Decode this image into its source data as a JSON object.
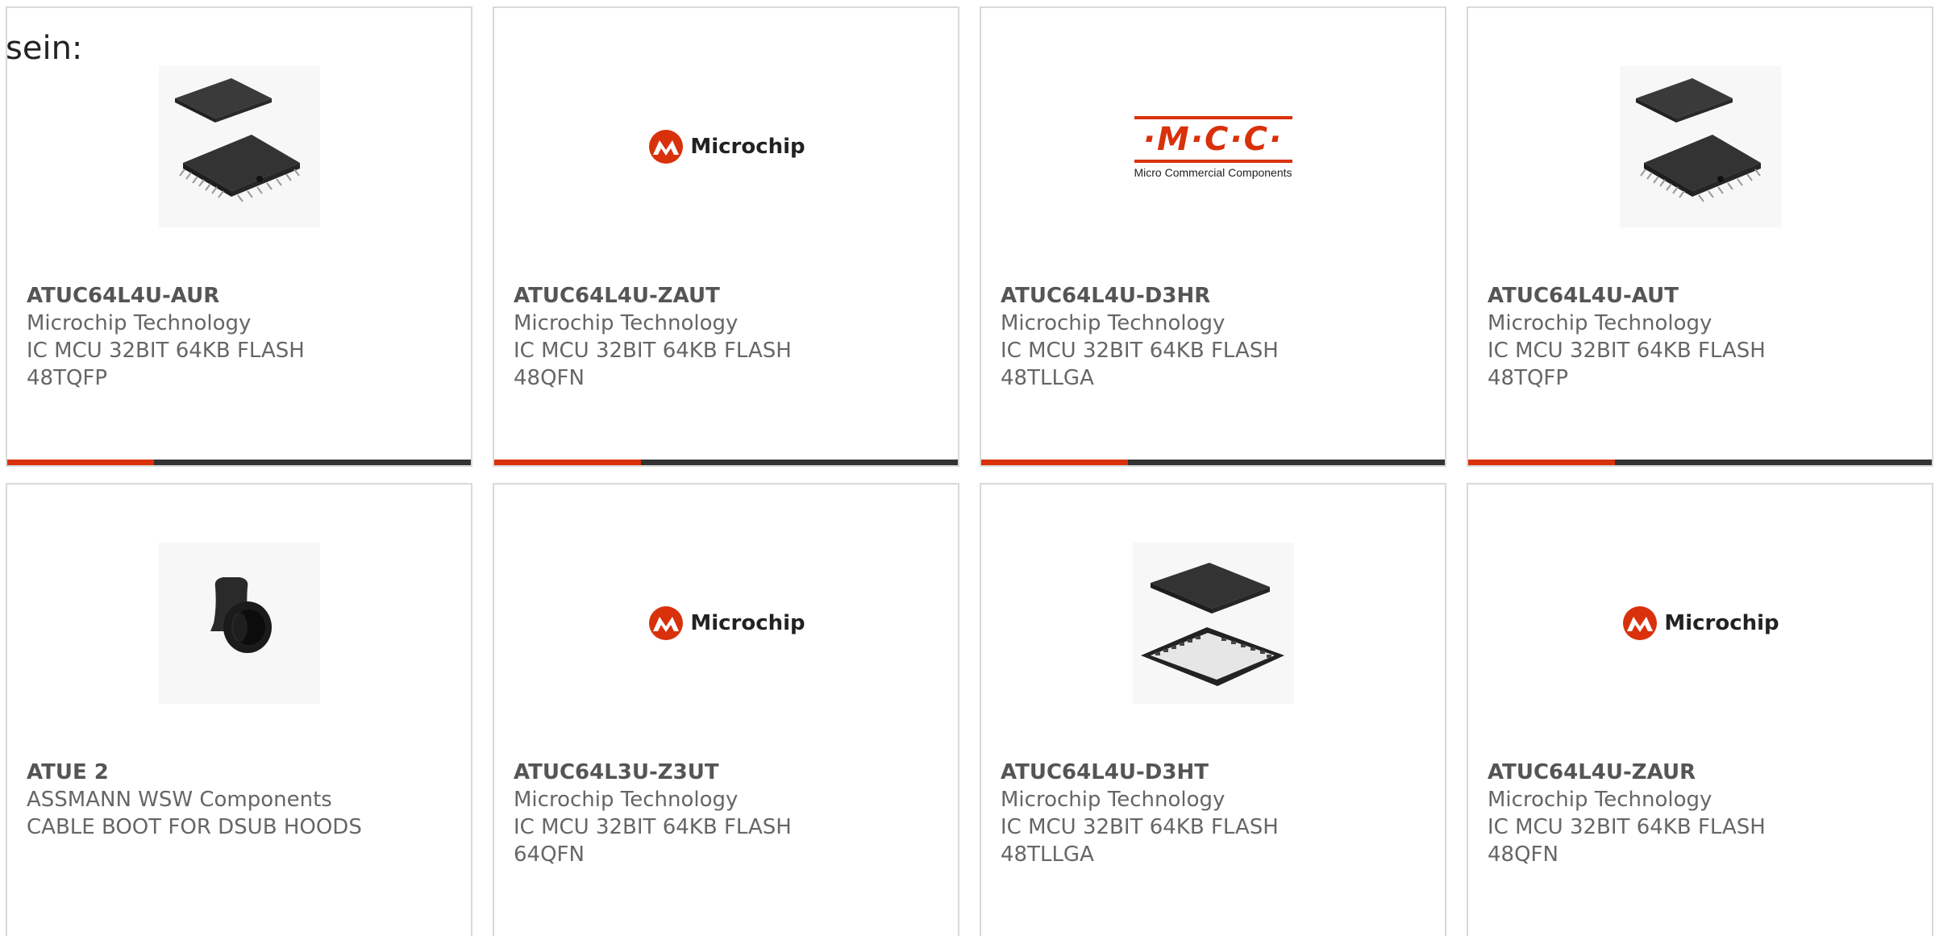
{
  "intro_text": "sein:",
  "cards": [
    {
      "part_number": "ATUC64L4U-AUR",
      "manufacturer": "Microchip Technology",
      "desc": "IC MCU 32BIT 64KB FLASH",
      "package": "48TQFP",
      "image": "tqfp-chip"
    },
    {
      "part_number": "ATUC64L4U-ZAUT",
      "manufacturer": "Microchip Technology",
      "desc": "IC MCU 32BIT 64KB FLASH",
      "package": "48QFN",
      "image": "microchip-logo"
    },
    {
      "part_number": "ATUC64L4U-D3HR",
      "manufacturer": "Microchip Technology",
      "desc": "IC MCU 32BIT 64KB FLASH",
      "package": "48TLLGA",
      "image": "mcc-logo"
    },
    {
      "part_number": "ATUC64L4U-AUT",
      "manufacturer": "Microchip Technology",
      "desc": "IC MCU 32BIT 64KB FLASH",
      "package": "48TQFP",
      "image": "tqfp-chip"
    },
    {
      "part_number": "ATUE 2",
      "manufacturer": "ASSMANN WSW Components",
      "desc": "CABLE BOOT FOR DSUB HOODS",
      "package": "",
      "image": "cable-boot"
    },
    {
      "part_number": "ATUC64L3U-Z3UT",
      "manufacturer": "Microchip Technology",
      "desc": "IC MCU 32BIT 64KB FLASH",
      "package": "64QFN",
      "image": "microchip-logo"
    },
    {
      "part_number": "ATUC64L4U-D3HT",
      "manufacturer": "Microchip Technology",
      "desc": "IC MCU 32BIT 64KB FLASH",
      "package": "48TLLGA",
      "image": "lga-chip"
    },
    {
      "part_number": "ATUC64L4U-ZAUR",
      "manufacturer": "Microchip Technology",
      "desc": "IC MCU 32BIT 64KB FLASH",
      "package": "48QFN",
      "image": "microchip-logo"
    }
  ],
  "logos": {
    "microchip_word": "Microchip",
    "mcc_word": "·M·C·C·",
    "mcc_sub": "Micro Commercial Components"
  },
  "colors": {
    "accent": "#d9310b",
    "bar": "#333333",
    "border": "#d9d9d9",
    "text": "#666666"
  }
}
